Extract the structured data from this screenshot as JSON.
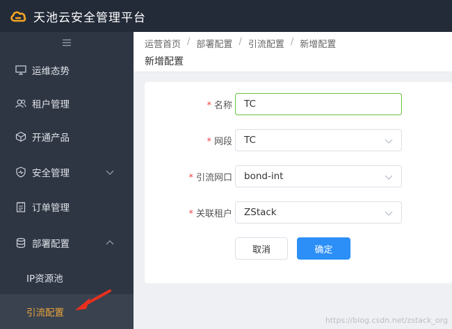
{
  "app": {
    "title": "天池云安全管理平台",
    "brand_color": "#f5a623"
  },
  "sidebar": {
    "toggle_icon": "hamburger-icon",
    "items": [
      {
        "label": "运维态势",
        "icon": "monitor-icon"
      },
      {
        "label": "租户管理",
        "icon": "users-icon"
      },
      {
        "label": "开通产品",
        "icon": "box-icon"
      },
      {
        "label": "安全管理",
        "icon": "shield-icon",
        "expanded": false
      },
      {
        "label": "订单管理",
        "icon": "order-icon"
      },
      {
        "label": "部署配置",
        "icon": "database-icon",
        "expanded": true
      }
    ],
    "sub_items": [
      {
        "label": "IP资源池"
      },
      {
        "label": "引流配置",
        "active": true
      }
    ],
    "active_color": "#e8a33a"
  },
  "header": {
    "breadcrumb": [
      "运营首页",
      "部署配置",
      "引流配置",
      "新增配置"
    ],
    "title": "新增配置"
  },
  "form": {
    "fields": [
      {
        "label": "名称",
        "value": "TC",
        "type": "text"
      },
      {
        "label": "网段",
        "value": "TC",
        "type": "select"
      },
      {
        "label": "引流网口",
        "value": "bond-int",
        "type": "select"
      },
      {
        "label": "关联租户",
        "value": "ZStack",
        "type": "select"
      }
    ],
    "cancel_label": "取消",
    "submit_label": "确定",
    "primary_color": "#2b8ff7"
  },
  "watermark": "https://blog.csdn.net/zstack_org"
}
